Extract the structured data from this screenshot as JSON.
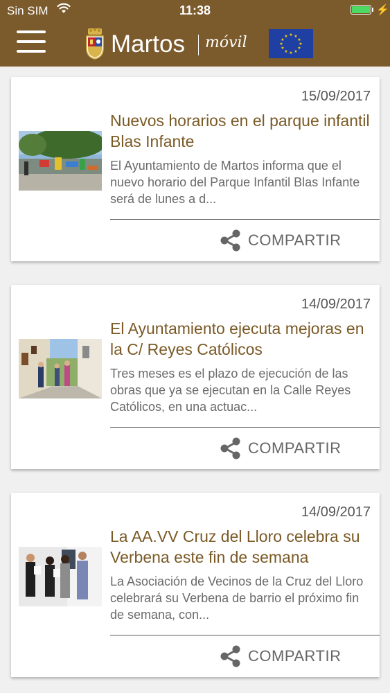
{
  "status_bar": {
    "carrier": "Sin SIM",
    "time": "11:38",
    "wifi_icon": "wifi-icon",
    "battery_icon": "battery-charging-icon",
    "battery_color": "#4cd964"
  },
  "header": {
    "brand": "Martos",
    "tagline": "móvil",
    "background_color": "#7b5a2c",
    "menu_icon": "hamburger-menu-icon",
    "crest_icon": "martos-coat-of-arms",
    "flag_icon": "european-union-flag"
  },
  "news": [
    {
      "date": "15/09/2017",
      "title": "Nuevos horarios en el parque infantil Blas Infante",
      "summary": "El Ayuntamiento de Martos informa que el nuevo horario del Parque Infantil Blas Infante será de lunes a d...",
      "share_label": "COMPARTIR",
      "image": "playground-photo"
    },
    {
      "date": "14/09/2017",
      "title": "El Ayuntamiento ejecuta mejoras en la C/ Reyes Católicos",
      "summary": "Tres meses es el plazo de ejecución de las obras que ya se ejecutan en la Calle Reyes Católicos, en una actuac...",
      "share_label": "COMPARTIR",
      "image": "street-photo"
    },
    {
      "date": "14/09/2017",
      "title": "La AA.VV Cruz del Lloro celebra su Verbena este fin de semana",
      "summary": "La Asociación de Vecinos de la Cruz del Lloro celebrará su Verbena de barrio el próximo fin de semana, con...",
      "share_label": "COMPARTIR",
      "image": "group-photo"
    }
  ],
  "colors": {
    "title": "#7a5a26",
    "text": "#6a6a6a",
    "page_background": "#f0f0f0"
  }
}
